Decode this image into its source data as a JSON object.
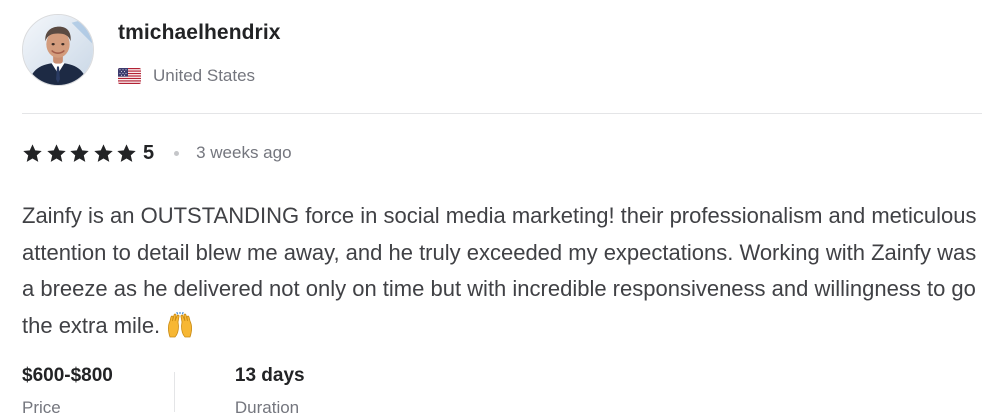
{
  "reviewer": {
    "username": "tmichaelhendrix",
    "country": "United States",
    "avatar_icon": "reviewer-avatar-photo",
    "flag_icon": "us-flag-icon"
  },
  "rating": {
    "stars": 5,
    "value": "5",
    "time_ago": "3 weeks ago",
    "star_color": "#222325"
  },
  "review": {
    "text": "Zainfy is an OUTSTANDING force in social media marketing! their professionalism and meticulous attention to detail blew me away, and he truly exceeded my expectations. Working with Zainfy was a breeze as he delivered not only on time but with incredible responsiveness and willingness to go the extra mile.",
    "emoji_icon": "raising-hands-emoji"
  },
  "meta": {
    "price": {
      "value": "$600-$800",
      "label": "Price"
    },
    "duration": {
      "value": "13 days",
      "label": "Duration"
    }
  }
}
